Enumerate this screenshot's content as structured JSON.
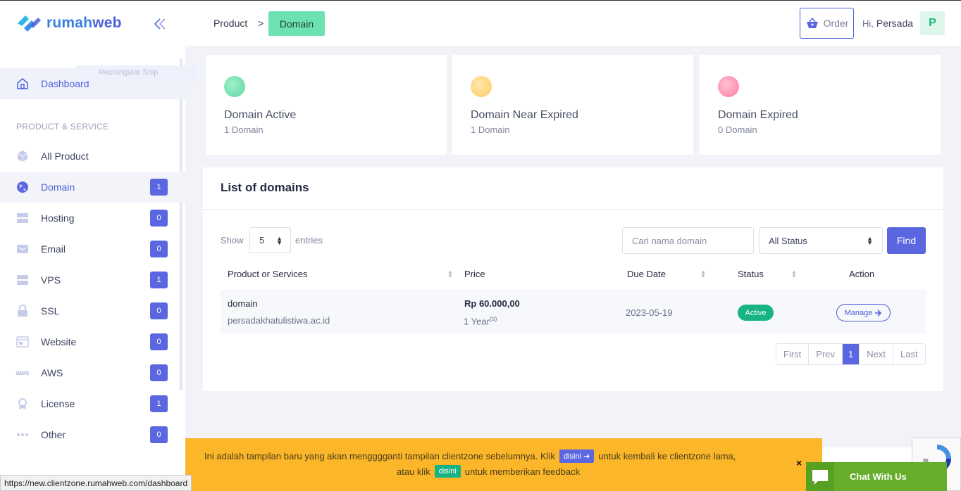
{
  "brand": {
    "name_part1": "rumah",
    "name_part2": "web"
  },
  "sidebar": {
    "dashboard_label": "Dashboard",
    "snip_ghost": "Rectangular Snip",
    "section_title": "PRODUCT & SERVICE",
    "items": [
      {
        "label": "All Product",
        "icon": "box-icon",
        "count": ""
      },
      {
        "label": "Domain",
        "icon": "globe-icon",
        "count": "1",
        "active": true
      },
      {
        "label": "Hosting",
        "icon": "server-icon",
        "count": "0"
      },
      {
        "label": "Email",
        "icon": "mail-icon",
        "count": "0"
      },
      {
        "label": "VPS",
        "icon": "vps-icon",
        "count": "1"
      },
      {
        "label": "SSL",
        "icon": "lock-icon",
        "count": "0"
      },
      {
        "label": "Website",
        "icon": "browser-icon",
        "count": "0"
      },
      {
        "label": "AWS",
        "icon": "aws-icon",
        "count": "0"
      },
      {
        "label": "License",
        "icon": "award-icon",
        "count": "1"
      },
      {
        "label": "Other",
        "icon": "dots-icon",
        "count": "0"
      }
    ]
  },
  "topbar": {
    "breadcrumb": {
      "parent": "Product",
      "separator": ">",
      "current": "Domain"
    },
    "order_label": "Order",
    "greeting": "Hi,",
    "user_name": "Persada",
    "avatar_initial": "P"
  },
  "stats": [
    {
      "title": "Domain Active",
      "sub": "1 Domain",
      "color": "#5fd6a3"
    },
    {
      "title": "Domain Near Expired",
      "sub": "1 Domain",
      "color": "#ffc95c"
    },
    {
      "title": "Domain Expired",
      "sub": "0 Domain",
      "color": "#ff7aa0"
    }
  ],
  "list": {
    "title": "List of domains",
    "show_label": "Show",
    "entries_value": "5",
    "entries_label": "entries",
    "search_placeholder": "Cari nama domain",
    "status_filter": "All Status",
    "find_label": "Find",
    "columns": [
      "Product or Services",
      "Price",
      "Due Date",
      "Status",
      "Action"
    ],
    "rows": [
      {
        "product": "domain",
        "domain": "persadakhatulistiwa.ac.id",
        "price": "Rp 60.000,00",
        "period": "1 Year",
        "period_suffix": "(s)",
        "due_date": "2023-05-19",
        "status": "Active",
        "action": "Manage"
      }
    ],
    "pager": {
      "first": "First",
      "prev": "Prev",
      "current": "1",
      "next": "Next",
      "last": "Last"
    }
  },
  "notice": {
    "text1": "Ini adalah tampilan baru yang akan mengggganti tampilan clientzone sebelumnya. Klik",
    "link1": "disini",
    "text2": "untuk kembali ke clientzone lama,",
    "text3": "atau klik",
    "link2": "disini",
    "text4": "untuk memberikan feedback",
    "close": "×"
  },
  "chat": {
    "label": "Chat With Us"
  },
  "browser_status": {
    "url": "https://new.clientzone.rumahweb.com/dashboard"
  },
  "colors": {
    "primary": "#5b66e1",
    "success": "#17b384",
    "breadcrumb_active": "#6de2b1",
    "notice": "#fbb62a",
    "chat": "#65ad2a"
  }
}
